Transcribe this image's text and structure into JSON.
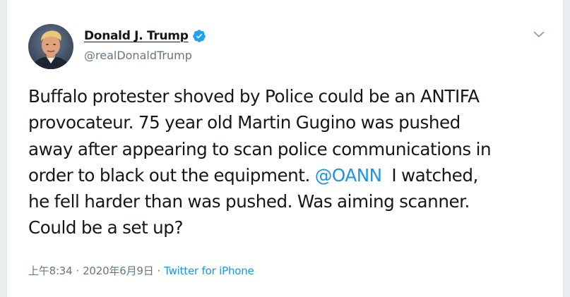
{
  "author": {
    "display_name": "Donald J. Trump",
    "handle": "@realDonaldTrump",
    "verified": true
  },
  "tweet": {
    "lines": [
      [
        "Buffalo protester shoved by Police could be an ANTIFA"
      ],
      [
        "provocateur. 75 year old Martin Gugino was pushed"
      ],
      [
        "away after appearing to scan police communications in"
      ],
      [
        "order to black out the equipment. ",
        "@OANN",
        "  I watched,"
      ],
      [
        "he fell harder than was pushed. Was aiming scanner."
      ],
      [
        "Could be a set up?"
      ]
    ],
    "line1": "Buffalo protester shoved by Police could be an ANTIFA",
    "line2": "provocateur. 75 year old Martin Gugino was pushed",
    "line3": "away after appearing to scan police communications in",
    "line4_pre": "order to black out the equipment. ",
    "mention": "@OANN",
    "line4_post": "  I watched,",
    "line5": "he fell harder than was pushed. Was aiming scanner.",
    "line6": "Could be a set up?"
  },
  "meta": {
    "time": "上午8:34",
    "separator": "·",
    "date": "2020年6月9日",
    "source": "Twitter for iPhone"
  },
  "icons": {
    "verified": "verified-badge-icon",
    "menu": "chevron-down-icon"
  },
  "colors": {
    "link": "#1b95e0",
    "text": "#14171a",
    "secondary": "#657786",
    "verified": "#1da1f2"
  }
}
